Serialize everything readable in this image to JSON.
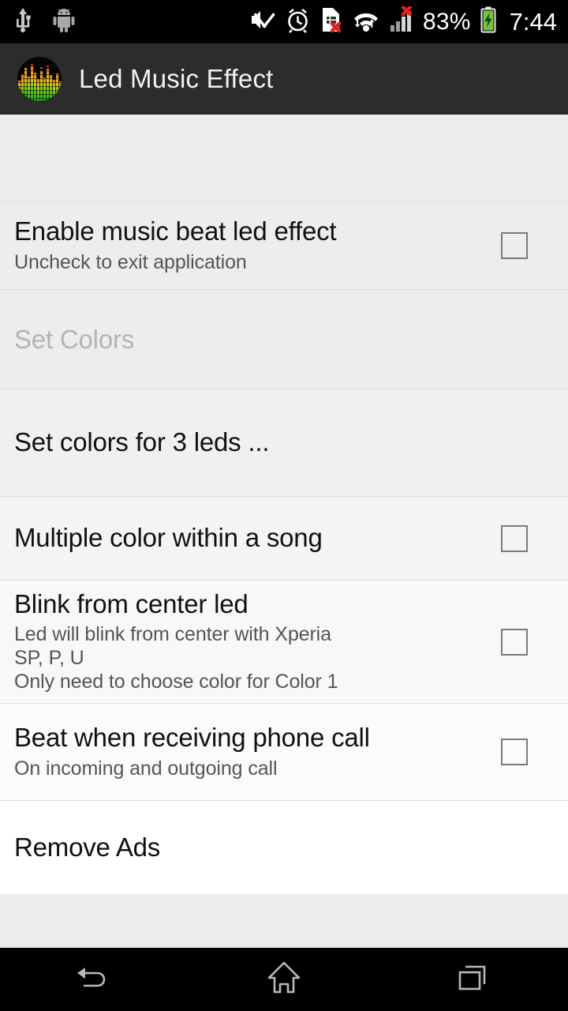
{
  "status_bar": {
    "left_icons": [
      {
        "name": "usb-icon",
        "label": "USB connected"
      },
      {
        "name": "android-icon",
        "label": "Android debugging"
      }
    ],
    "right_icons": [
      {
        "name": "vibrate-mute-icon",
        "label": "Vibrate / mute"
      },
      {
        "name": "alarm-clock-icon",
        "label": "Alarm set"
      },
      {
        "name": "sim-card-error-icon",
        "label": "No SIM card"
      },
      {
        "name": "wifi-icon",
        "label": "Wi-Fi connected"
      },
      {
        "name": "signal-error-icon",
        "label": "No mobile signal"
      }
    ],
    "battery_percent": "83%",
    "battery_icon": "battery-charging-icon",
    "time": "7:44"
  },
  "action_bar": {
    "icon_name": "app-logo-equalizer-icon",
    "title": "Led Music Effect"
  },
  "preferences": {
    "items": [
      {
        "key": "enable_effect",
        "title": "Enable music beat led effect",
        "subtitle_lines": [
          "Uncheck to exit application"
        ],
        "checkbox": true,
        "checked": false
      },
      {
        "key": "set_colors_header",
        "type": "section_header",
        "title": "Set Colors"
      },
      {
        "key": "set_colors_for_leds",
        "title": "Set colors for 3 leds ...",
        "subtitle_lines": [],
        "checkbox": false,
        "checked": false
      },
      {
        "key": "multiple_color",
        "title": "Multiple color within a song",
        "subtitle_lines": [],
        "checkbox": true,
        "checked": false
      },
      {
        "key": "blink_center",
        "title": "Blink from center led",
        "subtitle_lines": [
          "Led will blink from center with Xperia",
          "SP, P, U",
          "Only need to choose color for Color 1"
        ],
        "checkbox": true,
        "checked": false
      },
      {
        "key": "beat_phone_call",
        "title": "Beat when receiving phone call",
        "subtitle_lines": [
          "On incoming and outgoing call"
        ],
        "checkbox": true,
        "checked": false
      },
      {
        "key": "remove_ads",
        "title": "Remove Ads",
        "subtitle_lines": [],
        "checkbox": false,
        "checked": false
      }
    ]
  },
  "navigation_bar": {
    "buttons": [
      {
        "name": "back-button",
        "label": "Back"
      },
      {
        "name": "home-button",
        "label": "Home"
      },
      {
        "name": "recents-button",
        "label": "Recent apps"
      }
    ]
  },
  "colors": {
    "status_bar_bg": "#000000",
    "action_bar_bg": "#2c2c2c",
    "list_bg": "#ededed",
    "title_text": "#111111",
    "subtitle_text": "#555555",
    "section_header_text": "#b4b4b4",
    "checkbox_border": "#7b7b7b",
    "nav_icon": "#b8b8b8",
    "battery_green": "#7bc043",
    "error_red": "#e02020"
  }
}
